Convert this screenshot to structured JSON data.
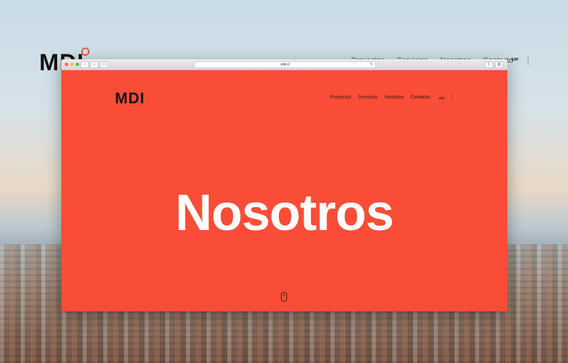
{
  "background": {
    "logo": "MDI",
    "nav": [
      "Proyectos",
      "Servicios",
      "Nosotros",
      "Contacto"
    ],
    "lang": "ESP",
    "menu_icon": "vertical-dots-icon"
  },
  "browser": {
    "url": "mdi.cl",
    "traffic_lights": [
      "#fc605c",
      "#fdbc40",
      "#34c84a"
    ]
  },
  "site": {
    "logo": "MDI",
    "nav": [
      "Proyectos",
      "Servicios",
      "Nosotros",
      "Contacto"
    ],
    "lang": "ESP",
    "hero_title": "Nosotros",
    "accent_color": "#f94d37",
    "scroll_icon": "mouse-scroll-icon"
  }
}
